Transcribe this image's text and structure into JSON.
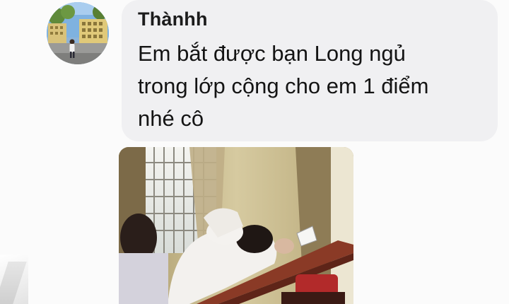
{
  "message": {
    "sender_name": "Thànhh",
    "lines": [
      "Em bắt được bạn Long ngủ",
      "trong lớp cộng cho em 1 điểm",
      "nhé cô"
    ]
  },
  "avatar": {
    "icon": "profile-photo-school-building"
  },
  "attachment": {
    "icon": "photo-classroom-student-sleeping"
  },
  "colors": {
    "bubble": "#f0f0f2",
    "text": "#141414",
    "background": "#fbfbfb"
  }
}
